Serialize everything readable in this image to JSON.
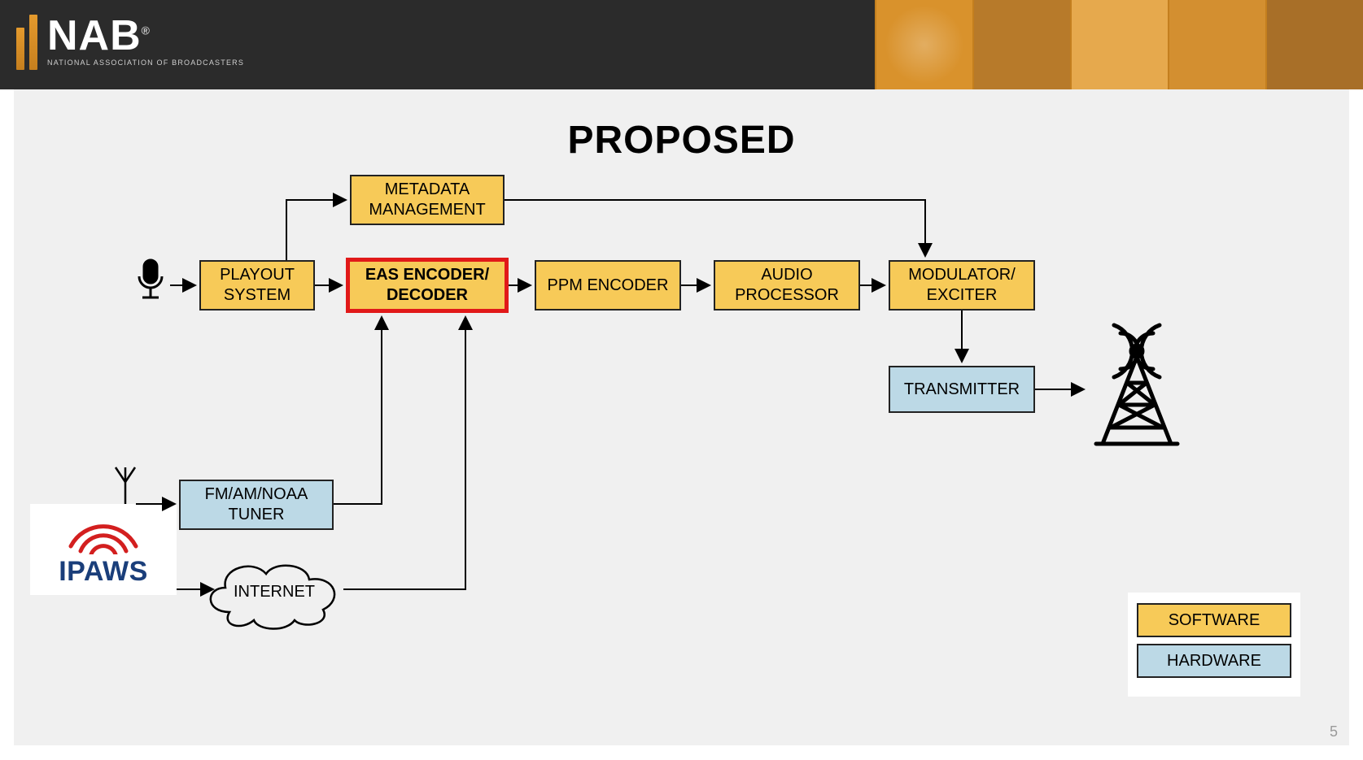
{
  "header": {
    "logo_text": "NAB",
    "logo_sub": "NATIONAL ASSOCIATION OF BROADCASTERS"
  },
  "title": "PROPOSED",
  "nodes": {
    "metadata": "METADATA MANAGEMENT",
    "playout": "PLAYOUT SYSTEM",
    "eas": "EAS ENCODER/ DECODER",
    "ppm": "PPM ENCODER",
    "audio": "AUDIO PROCESSOR",
    "modulator": "MODULATOR/ EXCITER",
    "transmitter": "TRANSMITTER",
    "tuner": "FM/AM/NOAA TUNER",
    "internet": "INTERNET"
  },
  "inputs": {
    "ipaws": "IPAWS"
  },
  "legend": {
    "software": "SOFTWARE",
    "hardware": "HARDWARE"
  },
  "page_number": "5",
  "colors": {
    "software_fill": "#f7ca58",
    "hardware_fill": "#bcd9e6",
    "highlight_border": "#e11919"
  }
}
